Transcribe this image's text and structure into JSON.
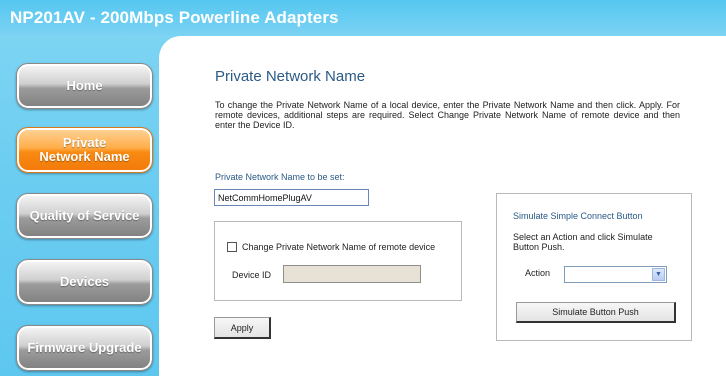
{
  "header": {
    "title": "NP201AV - 200Mbps Powerline Adapters"
  },
  "sidebar": {
    "items": [
      {
        "label": "Home",
        "active": false
      },
      {
        "label": "Private\nNetwork Name",
        "active": true
      },
      {
        "label": "Quality of Service",
        "active": false
      },
      {
        "label": "Devices",
        "active": false
      },
      {
        "label": "Firmware Upgrade",
        "active": false
      }
    ]
  },
  "main": {
    "title": "Private Network Name",
    "description": "To change the Private Network Name of a local device, enter the Private Network Name and then click. Apply. For remote devices, additional steps are required. Select Change Private Network Name of remote device and then enter the Device ID.",
    "name_label": "Private Network Name to be set:",
    "name_value": "NetCommHomePlugAV",
    "remote_checkbox_label": "Change Private Network Name of remote device",
    "remote_checked": false,
    "device_id_label": "Device ID",
    "device_id_value": "",
    "apply_label": "Apply"
  },
  "simulate": {
    "title": "Simulate Simple Connect Button",
    "instructions": "Select an Action and click Simulate Button Push.",
    "action_label": "Action",
    "action_value": "",
    "button_label": "Simulate Button Push"
  },
  "colors": {
    "header": "#55c7f0",
    "sidebar": "#6ccdf1",
    "active_nav": "#f88a12",
    "inactive_nav": "#8f8f8f",
    "title_text": "#2a5a86"
  }
}
